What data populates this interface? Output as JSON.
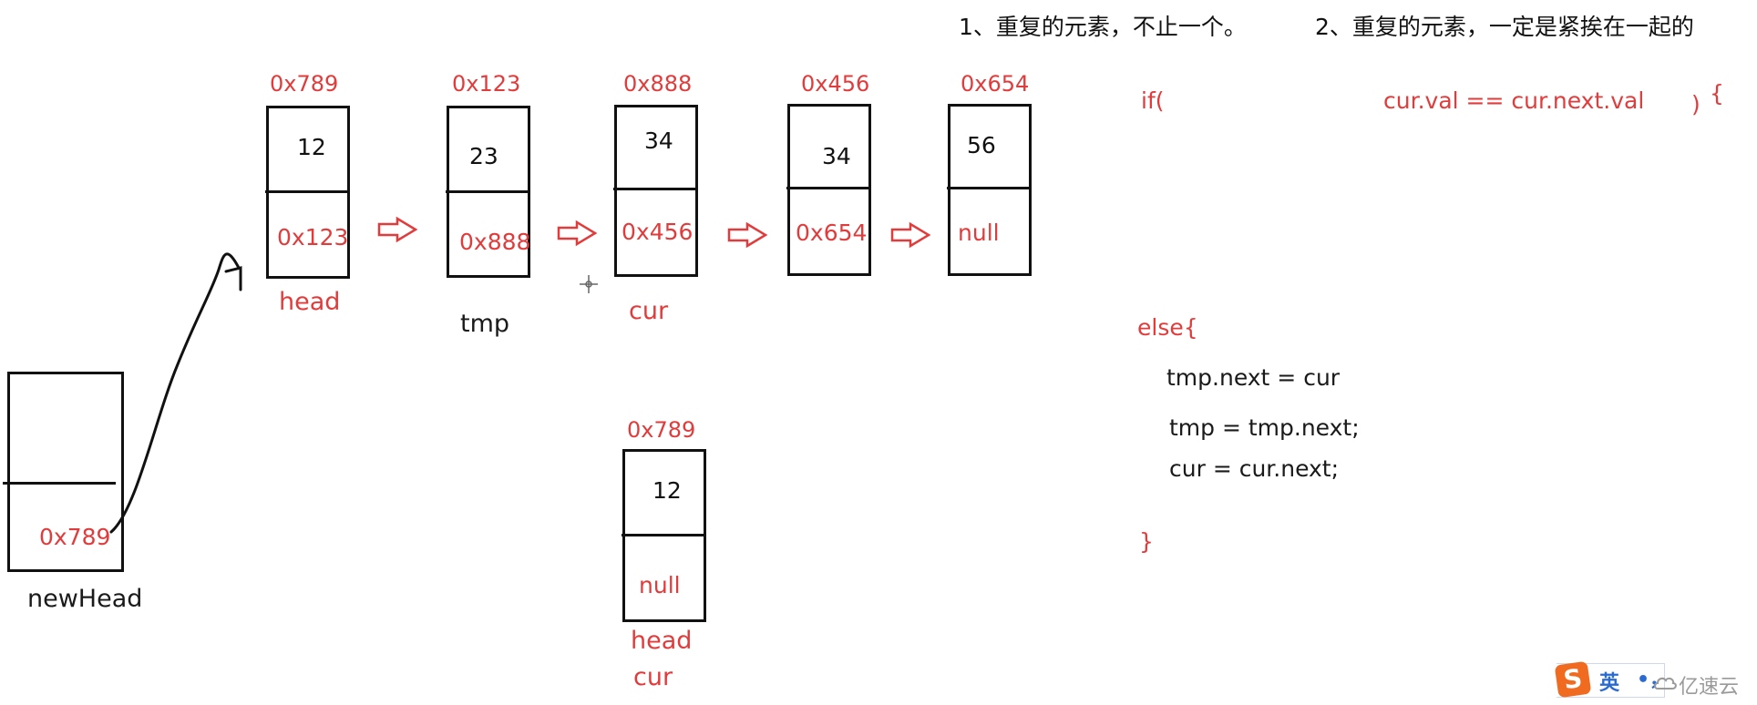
{
  "notes": {
    "note1": "1、重复的元素，不止一个。",
    "note2": "2、重复的元素，一定是紧挨在一起的"
  },
  "list_nodes": [
    {
      "address": "0x789",
      "val": "12",
      "next": "0x123",
      "pointer_label": "head"
    },
    {
      "address": "0x123",
      "val": "23",
      "next": "0x888",
      "pointer_label": "tmp"
    },
    {
      "address": "0x888",
      "val": "34",
      "next": "0x456",
      "pointer_label": "cur"
    },
    {
      "address": "0x456",
      "val": "34",
      "next": "0x654",
      "pointer_label": ""
    },
    {
      "address": "0x654",
      "val": "56",
      "next": "null",
      "pointer_label": ""
    }
  ],
  "new_head": {
    "val": "",
    "next": "0x789",
    "label": "newHead"
  },
  "result_node": {
    "address": "0x789",
    "val": "12",
    "next": "null",
    "labels": [
      "head",
      "cur"
    ]
  },
  "code": {
    "if_keyword": "if(",
    "if_condition": "cur.val == cur.next.val",
    "if_close": ")",
    "if_brace": "{",
    "else_open": "else{",
    "else_lines": [
      "tmp.next = cur",
      "tmp = tmp.next;",
      "cur = cur.next;"
    ],
    "else_close": "}"
  },
  "ime": {
    "logo": "S",
    "mode": "英",
    "punct": "•，"
  },
  "watermark": "亿速云",
  "colors": {
    "accent_red": "#e23b3b",
    "ink": "#111111",
    "ime_orange": "#f06a1f",
    "ime_blue": "#2a6bd1"
  }
}
